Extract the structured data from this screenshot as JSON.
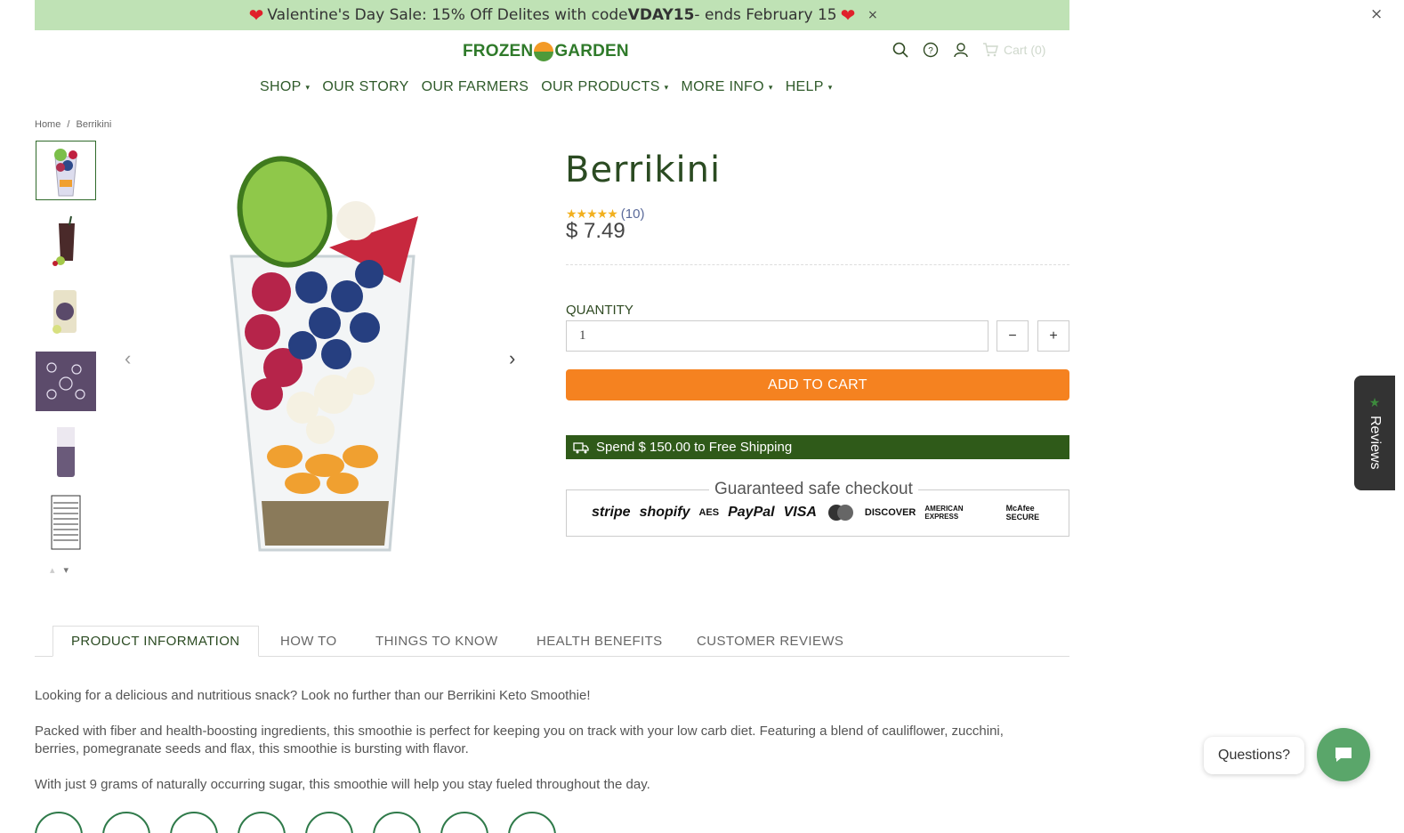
{
  "announcement": {
    "prefix": "Valentine's Day Sale: 15% Off Delites with code ",
    "code": "VDAY15",
    "suffix": " - ends February 15",
    "close": "×"
  },
  "page_close": "×",
  "logo": {
    "left": "FROZEN",
    "right": "GARDEN"
  },
  "cart_label": "Cart (0)",
  "nav": [
    {
      "label": "SHOP",
      "dropdown": true
    },
    {
      "label": "OUR STORY",
      "dropdown": false
    },
    {
      "label": "OUR FARMERS",
      "dropdown": false
    },
    {
      "label": "OUR PRODUCTS",
      "dropdown": true
    },
    {
      "label": "MORE INFO",
      "dropdown": true
    },
    {
      "label": "HELP",
      "dropdown": true
    }
  ],
  "breadcrumb": {
    "home": "Home",
    "separator": "/",
    "current": "Berrikini"
  },
  "product": {
    "title": "Berrikini",
    "rating_count": "(10)",
    "stars": "★★★★★",
    "price": "$ 7.49",
    "quantity_label": "QUANTITY",
    "quantity_value": "1",
    "minus": "−",
    "plus": "+",
    "add_to_cart": "ADD TO CART",
    "shipping": "Spend $ 150.00 to Free Shipping",
    "safe_checkout": "Guaranteed safe checkout"
  },
  "badges": [
    "stripe",
    "shopify",
    "AES",
    "PayPal",
    "VISA",
    "MasterCard",
    "DISCOVER",
    "AMERICAN EXPRESS",
    "McAfee SECURE"
  ],
  "reviews_tab": "Reviews",
  "tabs": [
    "PRODUCT INFORMATION",
    "HOW TO",
    "THINGS TO KNOW",
    "HEALTH BENEFITS",
    "CUSTOMER REVIEWS"
  ],
  "description": [
    "Looking for a delicious and nutritious snack? Look no further than our Berrikini Keto Smoothie!",
    "Packed with fiber and health-boosting ingredients, this smoothie is perfect for keeping you on track with your low carb diet. Featuring a blend of cauliflower, zucchini, berries, pomegranate seeds and flax, this smoothie is bursting with flavor.",
    "With just 9 grams of naturally occurring sugar, this smoothie will help you stay fueled throughout the day."
  ],
  "chat": {
    "questions": "Questions?"
  },
  "colors": {
    "accent": "#f58220",
    "brand_green": "#2f5a19",
    "announcement_bg": "#bfe2b5"
  }
}
